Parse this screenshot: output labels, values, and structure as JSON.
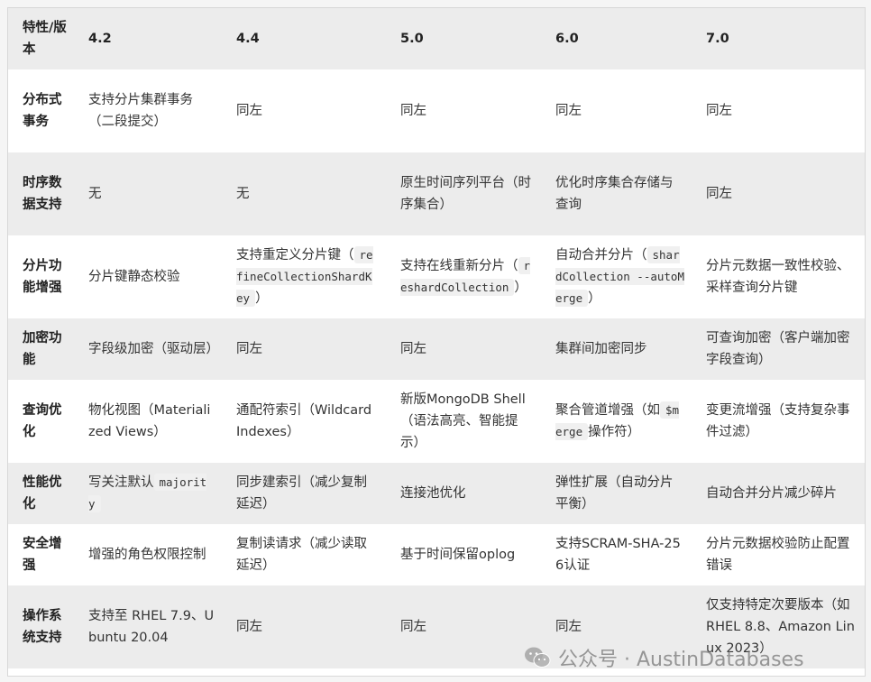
{
  "header": {
    "feature": "特性/版本",
    "versions": [
      "4.2",
      "4.4",
      "5.0",
      "6.0",
      "7.0"
    ]
  },
  "rows": [
    {
      "feature": "分布式事务",
      "cells": [
        {
          "text": "支持分片集群事务（二段提交）"
        },
        {
          "text": "同左"
        },
        {
          "text": "同左"
        },
        {
          "text": "同左"
        },
        {
          "text": "同左"
        }
      ]
    },
    {
      "feature": "时序数据支持",
      "cells": [
        {
          "text": "无"
        },
        {
          "text": "无"
        },
        {
          "text": "原生时间序列平台（时序集合）"
        },
        {
          "text": "优化时序集合存储与查询"
        },
        {
          "text": "同左"
        }
      ]
    },
    {
      "feature": "分片功能增强",
      "cells": [
        {
          "text": "分片键静态校验"
        },
        {
          "pre": "支持重定义分片键（",
          "code": "refineCollectionShardKey",
          "post": "）"
        },
        {
          "pre": "支持在线重新分片（",
          "code": "reshardCollection",
          "post": "）"
        },
        {
          "pre": "自动合并分片（",
          "code": "shardCollection --autoMerge",
          "post": "）"
        },
        {
          "text": "分片元数据一致性校验、采样查询分片键"
        }
      ]
    },
    {
      "feature": "加密功能",
      "cells": [
        {
          "text": "字段级加密（驱动层）"
        },
        {
          "text": "同左"
        },
        {
          "text": "同左"
        },
        {
          "text": "集群间加密同步"
        },
        {
          "text": "可查询加密（客户端加密字段查询）"
        }
      ]
    },
    {
      "feature": "查询优化",
      "cells": [
        {
          "text": "物化视图（Materialized Views）"
        },
        {
          "text": "通配符索引（Wildcard Indexes）"
        },
        {
          "text": "新版MongoDB Shell（语法高亮、智能提示）"
        },
        {
          "pre": "聚合管道增强（如",
          "code": "$merge",
          "post": "操作符）"
        },
        {
          "text": "变更流增强（支持复杂事件过滤）"
        }
      ]
    },
    {
      "feature": "性能优化",
      "cells": [
        {
          "pre": "写关注默认",
          "code": "majority",
          "post": ""
        },
        {
          "text": "同步建索引（减少复制延迟）"
        },
        {
          "text": "连接池优化"
        },
        {
          "text": "弹性扩展（自动分片平衡）"
        },
        {
          "text": "自动合并分片减少碎片"
        }
      ]
    },
    {
      "feature": "安全增强",
      "cells": [
        {
          "text": "增强的角色权限控制"
        },
        {
          "text": "复制读请求（减少读取延迟）"
        },
        {
          "text": "基于时间保留oplog"
        },
        {
          "text": "支持SCRAM-SHA-256认证"
        },
        {
          "text": "分片元数据校验防止配置错误"
        }
      ]
    },
    {
      "feature": "操作系统支持",
      "cells": [
        {
          "text": "支持至 RHEL 7.9、Ubuntu 20.04"
        },
        {
          "text": "同左"
        },
        {
          "text": "同左"
        },
        {
          "text": "同左"
        },
        {
          "text": "仅支持特定次要版本（如 RHEL 8.8、Amazon Linux 2023）"
        }
      ]
    }
  ],
  "watermark": {
    "text": "公众号 · AustinDatabases",
    "icon": "wechat-icon"
  }
}
